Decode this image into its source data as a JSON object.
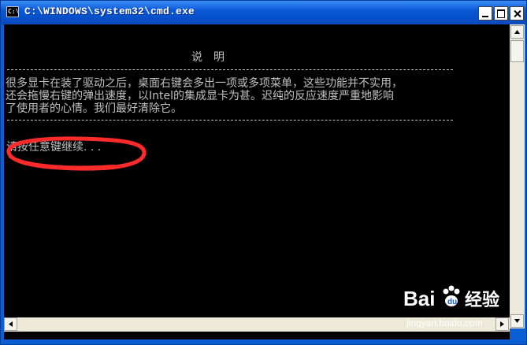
{
  "window": {
    "title": "C:\\WINDOWS\\system32\\cmd.exe",
    "icon_label": "C:\\"
  },
  "console": {
    "heading": "说明",
    "separator": "--------------------------------------------------------------------------------",
    "body_lines": [
      "很多显卡在装了驱动之后，桌面右键会多出一项或多项菜单，这些功能并不实用，",
      "还会拖慢右键的弹出速度，以Intel的集成显卡为甚。迟纯的反应速度严重地影响",
      "了使用者的心情。我们最好清除它。"
    ],
    "prompt": "请按任意键继续. . .",
    "text_color": "#c0c0c0",
    "background_color": "#000000",
    "annotation_color": "#ff2a2a"
  },
  "watermark": {
    "brand": "Bai",
    "brand2": "du",
    "product": "经验",
    "url": "jingyan.baidu.com"
  }
}
